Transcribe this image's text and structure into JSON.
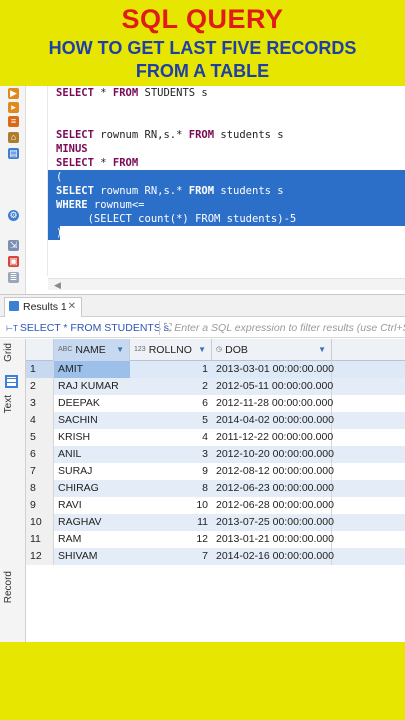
{
  "banner": {
    "title": "SQL QUERY",
    "subtitle_line1": "HOW TO GET LAST FIVE RECORDS",
    "subtitle_line2": "FROM A TABLE",
    "colors": {
      "background": "#e6e600",
      "title": "#e01b1b",
      "subtitle": "#1f3fa8"
    }
  },
  "editor": {
    "lines": [
      {
        "kw1": "SELECT",
        "rest": " * ",
        "kw2": "FROM",
        "tail": " STUDENTS s",
        "selected": false
      },
      {
        "kw1": "",
        "rest": "",
        "kw2": "",
        "tail": "",
        "selected": false
      },
      {
        "kw1": "SELECT",
        "rest": " rownum RN,s.* ",
        "kw2": "FROM",
        "tail": " students s",
        "selected": false
      },
      {
        "kw1": "MINUS",
        "rest": "",
        "kw2": "",
        "tail": "",
        "selected": false
      },
      {
        "kw1": "SELECT",
        "rest": " * ",
        "kw2": "FROM",
        "tail": "",
        "selected": false
      },
      {
        "kw1": "",
        "rest": "(",
        "kw2": "",
        "tail": "",
        "selected": true
      },
      {
        "kw1": "SELECT",
        "rest": " rownum RN,s.* ",
        "kw2": "FROM",
        "tail": " students s",
        "selected": true
      },
      {
        "kw1": "WHERE",
        "rest": " rownum<=",
        "kw2": "",
        "tail": "",
        "selected": true
      },
      {
        "kw1": "",
        "rest": "     (SELECT count(*) FROM students)-5",
        "kw2": "",
        "tail": "",
        "selected": true
      },
      {
        "kw1": "",
        "rest": ")",
        "kw2": "",
        "tail": "",
        "selected": true
      }
    ],
    "selection_color": "#2b6fc9"
  },
  "results": {
    "tab_label": "Results 1",
    "tab_close": "✕",
    "query_text": "SELECT * FROM STUDENTS s",
    "query_tag": "⊢T",
    "filter_placeholder": "Enter a SQL expression to filter results (use Ctrl+Sp",
    "side_tabs": [
      "Grid",
      "Text",
      "Record"
    ],
    "columns": [
      {
        "type_tag": "ABC",
        "name": "NAME"
      },
      {
        "type_tag": "123",
        "name": "ROLLNO"
      },
      {
        "type_tag": "◷",
        "name": "DOB"
      }
    ],
    "rows": [
      {
        "n": "1",
        "name": "AMIT",
        "roll": "1",
        "dob": "2013-03-01 00:00:00.000"
      },
      {
        "n": "2",
        "name": "RAJ KUMAR",
        "roll": "2",
        "dob": "2012-05-11 00:00:00.000"
      },
      {
        "n": "3",
        "name": "DEEPAK",
        "roll": "6",
        "dob": "2012-11-28 00:00:00.000"
      },
      {
        "n": "4",
        "name": "SACHIN",
        "roll": "5",
        "dob": "2014-04-02 00:00:00.000"
      },
      {
        "n": "5",
        "name": "KRISH",
        "roll": "4",
        "dob": "2011-12-22 00:00:00.000"
      },
      {
        "n": "6",
        "name": "ANIL",
        "roll": "3",
        "dob": "2012-10-20 00:00:00.000"
      },
      {
        "n": "7",
        "name": "SURAJ",
        "roll": "9",
        "dob": "2012-08-12 00:00:00.000"
      },
      {
        "n": "8",
        "name": "CHIRAG",
        "roll": "8",
        "dob": "2012-06-23 00:00:00.000"
      },
      {
        "n": "9",
        "name": "RAVI",
        "roll": "10",
        "dob": "2012-06-28 00:00:00.000"
      },
      {
        "n": "10",
        "name": "RAGHAV",
        "roll": "11",
        "dob": "2013-07-25 00:00:00.000"
      },
      {
        "n": "11",
        "name": "RAM",
        "roll": "12",
        "dob": "2013-01-21 00:00:00.000"
      },
      {
        "n": "12",
        "name": "SHIVAM",
        "roll": "7",
        "dob": "2014-02-16 00:00:00.000"
      }
    ]
  }
}
